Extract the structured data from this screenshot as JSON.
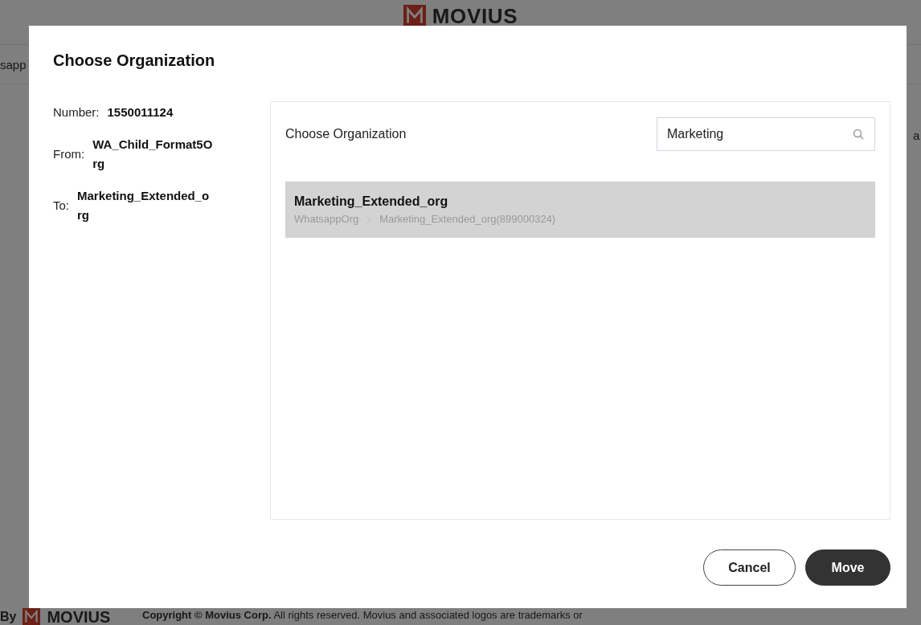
{
  "background": {
    "logo_text": "MOVIUS",
    "left_fragment": "sapp",
    "right_fragment": "a",
    "footer": {
      "by": "By",
      "logo_text": "MOVIUS",
      "copyright": "**Copyright © Movius Corp.** All rights reserved. Movius and associated logos are trademarks or"
    }
  },
  "dialog": {
    "title": "Choose Organization",
    "details": [
      {
        "label": "Number:",
        "value": "1550011124"
      },
      {
        "label": "From:",
        "value": "WA_Child_Format5O rg"
      },
      {
        "label": "To:",
        "value": "Marketing_Extended_o rg"
      }
    ],
    "panel": {
      "title": "Choose Organization",
      "search": {
        "value": "Marketing"
      },
      "results": [
        {
          "name": "Marketing_Extended_org",
          "path": [
            "WhatsappOrg",
            "Marketing_Extended_org(899000324)"
          ],
          "selected": true
        }
      ]
    },
    "buttons": [
      {
        "label": "Cancel",
        "kind": "secondary"
      },
      {
        "label": "Move",
        "kind": "primary"
      }
    ]
  }
}
